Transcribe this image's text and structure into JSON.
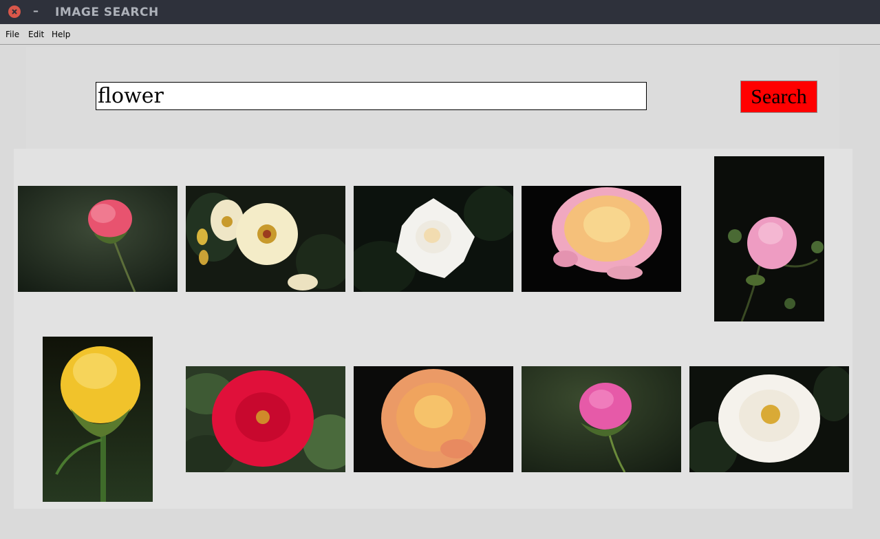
{
  "window": {
    "title": "IMAGE SEARCH",
    "minimize_glyph": "–"
  },
  "menu": {
    "items": [
      "File",
      "Edit",
      "Help"
    ]
  },
  "search": {
    "query": "flower",
    "button_label": "Search",
    "button_color": "#ff0000"
  },
  "results": [
    {
      "subject": "pink rose bud",
      "orientation": "landscape",
      "background": "#1f2a1f",
      "petal_color": "#e8536f"
    },
    {
      "subject": "cream wild roses",
      "orientation": "landscape",
      "background": "#141a12",
      "petal_color": "#f4ecc8"
    },
    {
      "subject": "white rose",
      "orientation": "landscape",
      "background": "#0c120d",
      "petal_color": "#f3f2ee"
    },
    {
      "subject": "peach and pink rose",
      "orientation": "landscape",
      "background": "#050505",
      "petal_color": "#f5c07a"
    },
    {
      "subject": "pink rose with buds",
      "orientation": "portrait",
      "background": "#0b0d0a",
      "petal_color": "#ee9cc2"
    },
    {
      "subject": "yellow rose",
      "orientation": "portrait",
      "background": "#1a2214",
      "petal_color": "#f1c32b"
    },
    {
      "subject": "red rose",
      "orientation": "landscape",
      "background": "#2a3a25",
      "petal_color": "#e0103a"
    },
    {
      "subject": "orange rose",
      "orientation": "landscape",
      "background": "#0b0b0a",
      "petal_color": "#f0a45e"
    },
    {
      "subject": "magenta rose bud",
      "orientation": "landscape",
      "background": "#2a3322",
      "petal_color": "#e65aa8"
    },
    {
      "subject": "white full rose",
      "orientation": "landscape",
      "background": "#0d110c",
      "petal_color": "#f5f2ec"
    }
  ]
}
